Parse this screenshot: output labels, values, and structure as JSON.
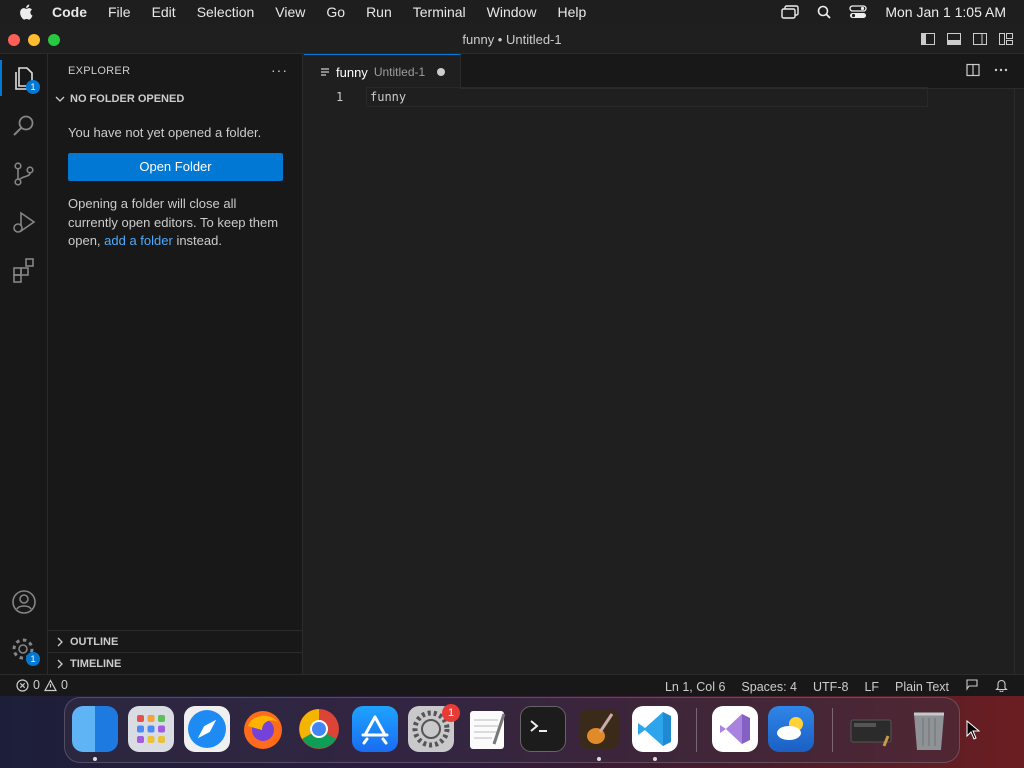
{
  "menubar": {
    "app_name": "Code",
    "items": [
      "File",
      "Edit",
      "Selection",
      "View",
      "Go",
      "Run",
      "Terminal",
      "Window",
      "Help"
    ],
    "clock": "Mon Jan 1  1:05 AM"
  },
  "window": {
    "title": "funny • Untitled-1"
  },
  "activity": {
    "explorer_badge": "1",
    "manage_badge": "1"
  },
  "sidebar": {
    "title": "EXPLORER",
    "more": "···",
    "section": "NO FOLDER OPENED",
    "message": "You have not yet opened a folder.",
    "open_folder_label": "Open Folder",
    "hint_part1": "Opening a folder will close all currently open editors. To keep them open, ",
    "hint_link": "add a folder",
    "hint_part2": " instead.",
    "outline": "OUTLINE",
    "timeline": "TIMELINE"
  },
  "editor": {
    "tab_name": "funny",
    "tab_desc": "Untitled-1",
    "lines": [
      {
        "no": "1",
        "text": "funny"
      }
    ]
  },
  "statusbar": {
    "errors": "0",
    "warnings": "0",
    "position": "Ln 1, Col 6",
    "spaces": "Spaces: 4",
    "encoding": "UTF-8",
    "eol": "LF",
    "language": "Plain Text"
  },
  "dock": {
    "settings_badge": "1"
  }
}
